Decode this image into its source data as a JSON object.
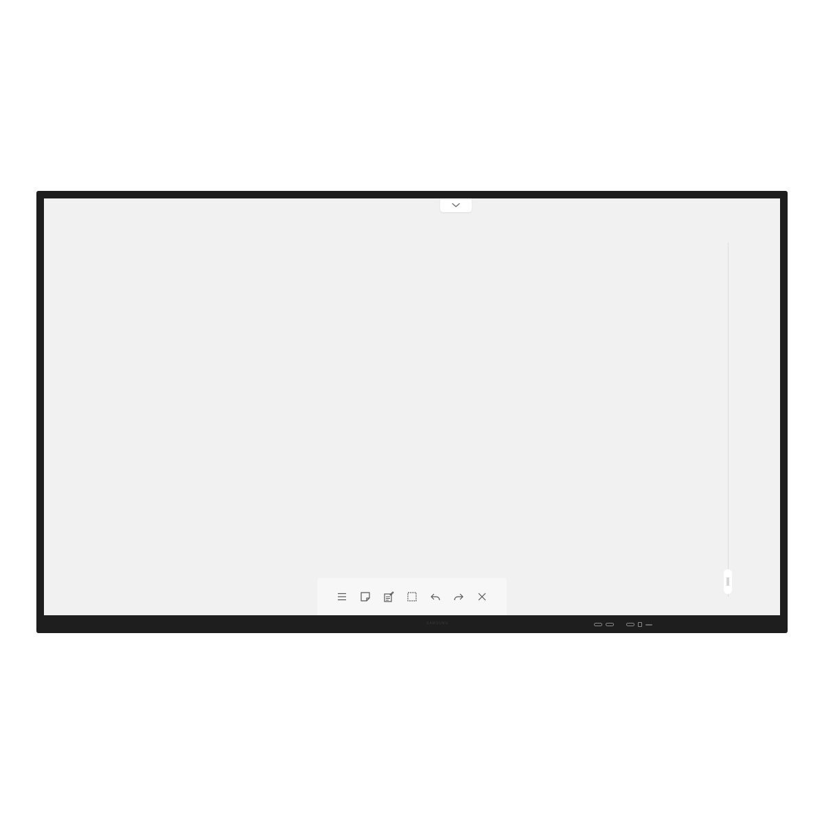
{
  "device": {
    "brand": "SAMSUNG"
  },
  "top_tab": {
    "icon": "chevron-down-icon"
  },
  "toolbar": {
    "tools": [
      {
        "name": "menu",
        "icon": "menu-icon"
      },
      {
        "name": "sticky-note",
        "icon": "sticky-note-icon"
      },
      {
        "name": "insert",
        "icon": "insert-document-icon"
      },
      {
        "name": "select",
        "icon": "select-area-icon"
      },
      {
        "name": "undo",
        "icon": "undo-icon"
      },
      {
        "name": "redo",
        "icon": "redo-icon"
      },
      {
        "name": "close",
        "icon": "close-icon"
      }
    ]
  },
  "side_panel": {
    "icon": "grip-handle-icon"
  },
  "colors": {
    "bezel": "#1e1e1e",
    "canvas": "#f1f1f1",
    "toolbar_bg": "#f7f7f7",
    "icon": "#555555"
  }
}
